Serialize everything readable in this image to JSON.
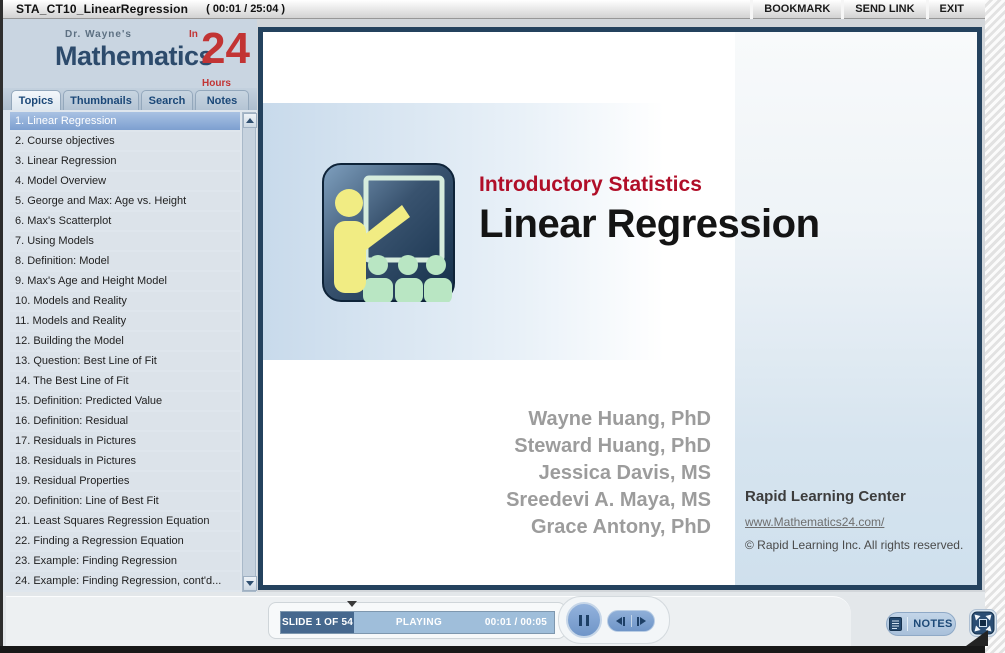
{
  "window": {
    "title": "STA_CT10_LinearRegression",
    "elapsed": "( 00:01 / 25:04 )",
    "menu": [
      "BOOKMARK",
      "SEND LINK",
      "EXIT"
    ]
  },
  "logo": {
    "tagline": "Dr. Wayne's",
    "brand": "Mathematics",
    "in_word": "In",
    "number": "24",
    "hours_word": "Hours"
  },
  "tabs": [
    "Topics",
    "Thumbnails",
    "Search",
    "Notes"
  ],
  "sidebar": {
    "topics": [
      "1. Linear Regression",
      "2. Course objectives",
      "3. Linear Regression",
      "4. Model Overview",
      "5. George and Max: Age vs. Height",
      "6. Max's Scatterplot",
      "7. Using Models",
      "8. Definition: Model",
      "9. Max's Age and Height Model",
      "10. Models and Reality",
      "11. Models and Reality",
      "12. Building the Model",
      "13. Question: Best Line of Fit",
      "14. The Best Line of Fit",
      "15. Definition: Predicted Value",
      "16. Definition: Residual",
      "17. Residuals in Pictures",
      "18. Residuals in Pictures",
      "19. Residual Properties",
      "20. Definition: Line of Best Fit",
      "21. Least Squares Regression Equation",
      "22. Finding a Regression Equation",
      "23. Example: Finding Regression",
      "24. Example: Finding Regression, cont'd..."
    ]
  },
  "slide": {
    "eyebrow": "Introductory Statistics",
    "title": "Linear Regression",
    "authors": [
      "Wayne Huang, PhD",
      "Steward Huang, PhD",
      "Jessica Davis, MS",
      "Sreedevi A. Maya, MS",
      "Grace Antony, PhD"
    ],
    "footer": {
      "org": "Rapid Learning Center",
      "url": "www.Mathematics24.com/",
      "copyright": "© Rapid Learning Inc. All rights reserved."
    }
  },
  "controls": {
    "slide_label": "SLIDE 1 OF 54",
    "status": "PLAYING",
    "time": "00:01 / 00:05",
    "notes": "NOTES"
  },
  "colors": {
    "accent_red": "#b00e28",
    "frame_navy": "#24425e",
    "selected_item_blue": "#7d9fd0",
    "progress_dark": "#46688e",
    "progress_light": "#9fbeda"
  }
}
